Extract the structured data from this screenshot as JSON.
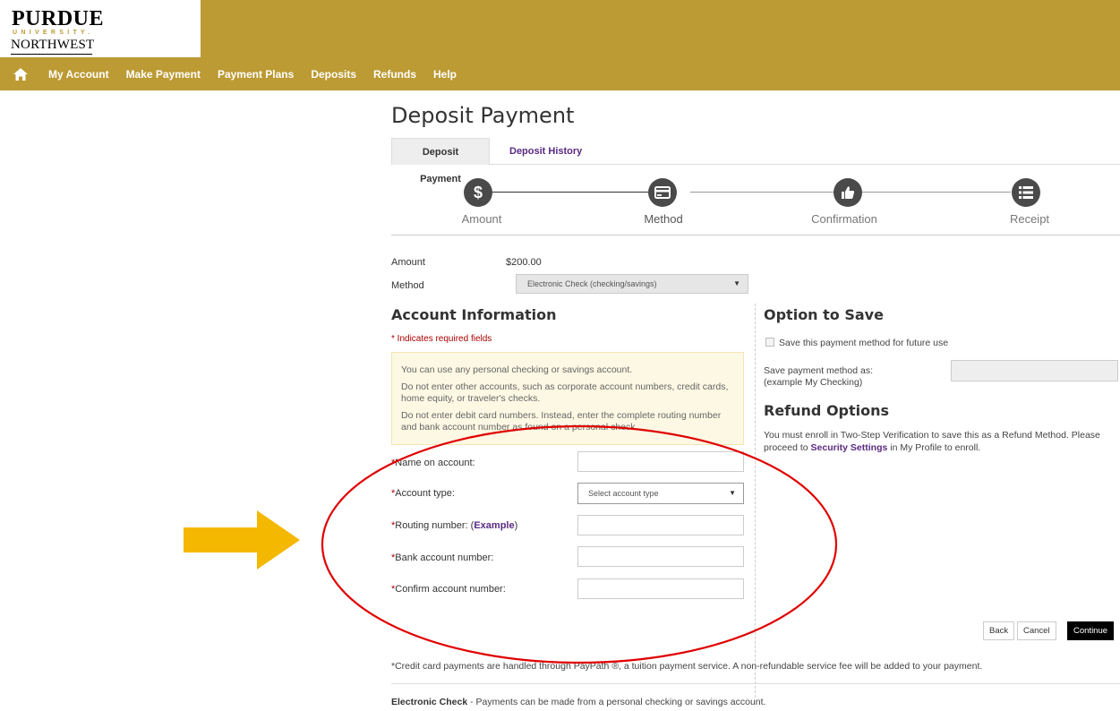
{
  "logo": {
    "line1": "PURDUE",
    "line2": "UNIVERSITY.",
    "line3": "NORTHWEST"
  },
  "nav": {
    "items": [
      "My Account",
      "Make Payment",
      "Payment Plans",
      "Deposits",
      "Refunds",
      "Help"
    ]
  },
  "page": {
    "title": "Deposit Payment"
  },
  "tabs": {
    "active": "Deposit Payment",
    "inactive": "Deposit History"
  },
  "steps": [
    {
      "label": "Amount",
      "icon": "dollar-icon"
    },
    {
      "label": "Method",
      "icon": "credit-card-icon"
    },
    {
      "label": "Confirmation",
      "icon": "thumbs-up-icon"
    },
    {
      "label": "Receipt",
      "icon": "list-icon"
    }
  ],
  "summary": {
    "amount_label": "Amount",
    "amount_value": "$200.00",
    "method_label": "Method",
    "method_value": "Electronic Check (checking/savings)"
  },
  "account": {
    "title": "Account Information",
    "required_note": "* Indicates required fields",
    "info": [
      "You can use any personal checking or savings account.",
      "Do not enter other accounts, such as corporate account numbers, credit cards, home equity, or traveler's checks.",
      "Do not enter debit card numbers. Instead, enter the complete routing number and bank account number as found on a personal check."
    ],
    "fields": {
      "name": "Name on account:",
      "type": "Account type:",
      "type_placeholder": "Select account type",
      "routing": "Routing number: ",
      "routing_link": "Example",
      "bank": "Bank account number:",
      "confirm": "Confirm account number:"
    }
  },
  "save": {
    "title": "Option to Save",
    "checkbox": "Save this payment method for future use",
    "save_as_line1": "Save payment method as:",
    "save_as_line2": "(example My Checking)"
  },
  "refund": {
    "title": "Refund Options",
    "text_before": "You must enroll in Two-Step Verification to save this as a Refund Method. Please proceed to ",
    "link": "Security Settings",
    "text_after": " in My Profile to enroll."
  },
  "buttons": {
    "back": "Back",
    "cancel": "Cancel",
    "continue": "Continue"
  },
  "footnote": "*Credit card payments are handled through PayPath ®, a tuition payment service. A non-refundable service fee will be added to your payment.",
  "echeck": {
    "bold": "Electronic Check",
    "text": " - Payments can be made from a personal checking or savings  account."
  },
  "colors": {
    "header": "#bc9a34",
    "link": "#5a2a82",
    "annotation_arrow": "#f5b800",
    "annotation_ellipse": "#e00000"
  }
}
